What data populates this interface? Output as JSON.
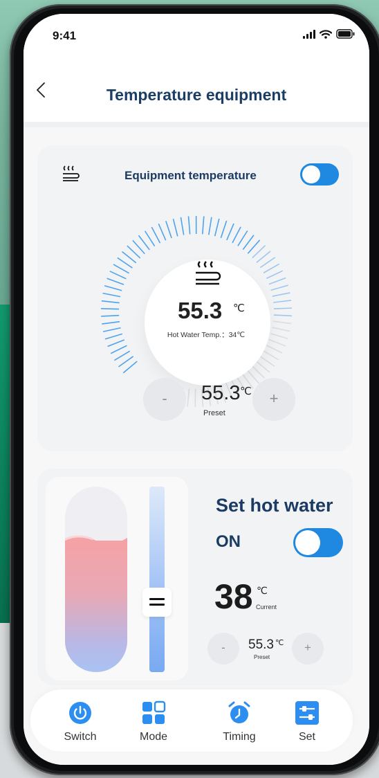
{
  "status": {
    "time": "9:41"
  },
  "header": {
    "title": "Temperature equipment"
  },
  "equipment": {
    "label": "Equipment temperature",
    "toggle_on": true,
    "temperature": "55.3",
    "unit": "℃",
    "subtitle": "Hot Water Temp.：34℃",
    "preset_value": "55.3",
    "preset_unit": "℃",
    "preset_label": "Preset",
    "minus": "-",
    "plus": "+"
  },
  "hot_water": {
    "title": "Set hot water",
    "state": "ON",
    "toggle_on": true,
    "current_value": "38",
    "current_unit": "℃",
    "current_label": "Current",
    "preset_value": "55.3",
    "preset_unit": "℃",
    "preset_label": "Preset",
    "minus": "-",
    "plus": "+"
  },
  "nav": {
    "items": [
      {
        "label": "Switch",
        "icon": "power-icon"
      },
      {
        "label": "Mode",
        "icon": "grid-icon"
      },
      {
        "label": "Timing",
        "icon": "alarm-clock-icon"
      },
      {
        "label": "Set",
        "icon": "sliders-icon"
      }
    ]
  },
  "colors": {
    "accent": "#1f88e0",
    "title": "#1b3b64"
  }
}
